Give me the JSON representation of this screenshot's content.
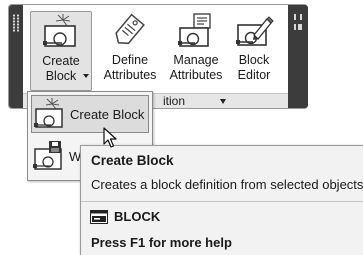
{
  "ribbon_panel": {
    "title": "ition",
    "tools": [
      {
        "label_line1": "Create",
        "label_line2": "Block",
        "icon": "create-block-icon",
        "active": true
      },
      {
        "label_line1": "Define",
        "label_line2": "Attributes",
        "icon": "define-attributes-icon"
      },
      {
        "label_line1": "Manage",
        "label_line2": "Attributes",
        "icon": "manage-attributes-icon"
      },
      {
        "label_line1": "Block",
        "label_line2": "Editor",
        "icon": "block-editor-icon"
      }
    ]
  },
  "dropdown": {
    "items": [
      {
        "label": "Create Block",
        "icon": "create-block-icon",
        "highlighted": true
      },
      {
        "label": "W",
        "icon": "write-block-icon"
      }
    ]
  },
  "tooltip": {
    "title": "Create Block",
    "description": "Creates a block definition from selected objects",
    "command": "BLOCK",
    "help": "Press F1 for more help"
  },
  "colors": {
    "panel_border": "#9a9a9a",
    "grip": "#3c3c3c",
    "highlight": "#dcdcdc",
    "tooltip_bg": "#f2f2f2"
  }
}
